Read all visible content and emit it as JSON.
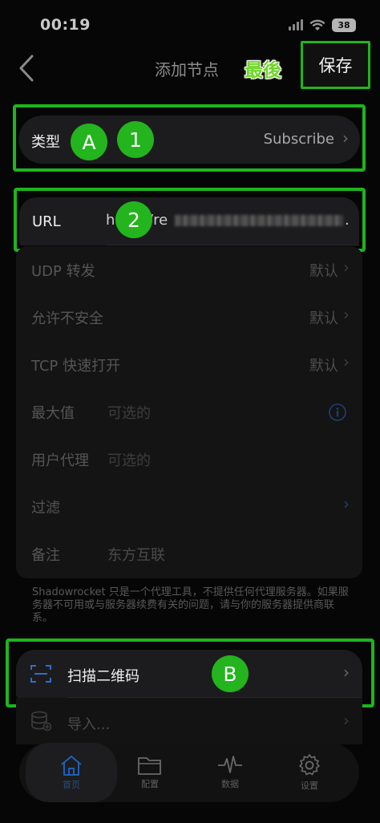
{
  "status_bar": {
    "time": "00:19",
    "battery": "38"
  },
  "nav": {
    "title": "添加节点",
    "badge": "最後",
    "save": "保存"
  },
  "type_row": {
    "label": "类型",
    "value": "Subscribe",
    "badge_a": "A",
    "badge_1": "1"
  },
  "url_row": {
    "label": "URL",
    "value": "h",
    "value_tail": "/re",
    "value_end": ".",
    "badge_2": "2"
  },
  "rows": [
    {
      "label": "UDP 转发",
      "value": "默认"
    },
    {
      "label": "允许不安全",
      "value": "默认"
    },
    {
      "label": "TCP 快速打开",
      "value": "默认"
    },
    {
      "label": "最大值",
      "placeholder": "可选的"
    },
    {
      "label": "用户代理",
      "placeholder": "可选的"
    },
    {
      "label": "过滤"
    },
    {
      "label": "备注",
      "value": "东方互联"
    }
  ],
  "footnote": "Shadowrocket 只是一个代理工具，不提供任何代理服务器。如果服务器不可用或与服务器续费有关的问题，请与你的服务器提供商联系。",
  "scan": {
    "label": "扫描二维码",
    "badge": "B"
  },
  "import": {
    "label": "导入..."
  },
  "tabs": [
    {
      "label": "首页",
      "icon": "house-icon"
    },
    {
      "label": "配置",
      "icon": "folder-icon"
    },
    {
      "label": "数据",
      "icon": "pulse-icon"
    },
    {
      "label": "设置",
      "icon": "gear-icon"
    }
  ],
  "colors": {
    "highlight_green": "#1db51d",
    "badge_green": "#23b41e",
    "accent_blue": "#1f5fb8"
  }
}
